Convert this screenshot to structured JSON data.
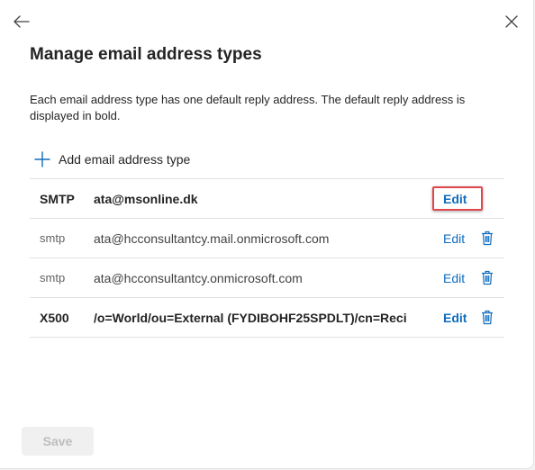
{
  "panel": {
    "title": "Manage email address types",
    "description": "Each email address type has one default reply address. The default reply address is displayed in bold."
  },
  "icons": {
    "back": "arrow-left-icon",
    "close": "close-icon",
    "add": "plus-icon",
    "delete": "trash-icon"
  },
  "add_button_label": "Add email address type",
  "rows": [
    {
      "type": "SMTP",
      "address": "ata@msonline.dk",
      "edit_label": "Edit",
      "bold": true,
      "has_delete": false,
      "highlighted": true
    },
    {
      "type": "smtp",
      "address": "ata@hcconsultantcy.mail.onmicrosoft.com",
      "edit_label": "Edit",
      "bold": false,
      "has_delete": true
    },
    {
      "type": "smtp",
      "address": "ata@hcconsultantcy.onmicrosoft.com",
      "edit_label": "Edit",
      "bold": false,
      "has_delete": true
    },
    {
      "type": "X500",
      "address": "/o=World/ou=External (FYDIBOHF25SPDLT)/cn=Reci",
      "edit_label": "Edit",
      "bold": true,
      "has_delete": true
    }
  ],
  "save_label": "Save",
  "colors": {
    "accent": "#0f6cbd",
    "highlight": "#e0474c"
  }
}
